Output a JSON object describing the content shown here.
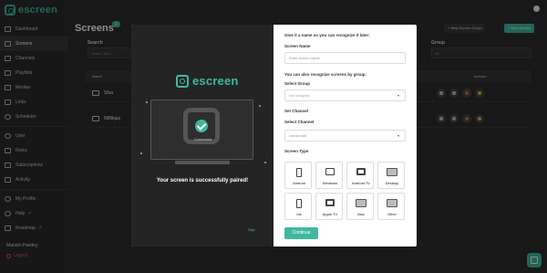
{
  "app": {
    "brand": "escreen"
  },
  "sidebar": {
    "items": [
      {
        "label": "Dashboard",
        "icon": "home-icon"
      },
      {
        "label": "Screens",
        "icon": "monitor-icon",
        "active": true
      },
      {
        "label": "Channels",
        "icon": "channel-icon"
      },
      {
        "label": "Playlists",
        "icon": "playlist-icon"
      },
      {
        "label": "Medias",
        "icon": "media-icon"
      },
      {
        "label": "Links",
        "icon": "link-icon"
      },
      {
        "label": "Scheduler",
        "icon": "clock-icon"
      },
      {
        "label": "User",
        "icon": "user-icon"
      },
      {
        "label": "Roles",
        "icon": "roles-icon"
      },
      {
        "label": "Subscriptions",
        "icon": "subscription-icon"
      },
      {
        "label": "Activity",
        "icon": "activity-icon"
      },
      {
        "label": "My Profile",
        "icon": "profile-icon"
      },
      {
        "label": "Help",
        "icon": "help-icon"
      },
      {
        "label": "Roadmap",
        "icon": "roadmap-icon"
      }
    ],
    "user_name": "Manish Pandey",
    "logout": "Logout"
  },
  "main": {
    "title": "Screens",
    "count": "2",
    "new_group": "+ New Screen Group",
    "new_screen": "+ New Screen",
    "search_label": "Search",
    "search_placeholder": "Search here",
    "group_label": "Group",
    "group_value": "All",
    "columns": {
      "name": "Name",
      "actions": "Actions"
    },
    "rows": [
      {
        "name": "Sfsa"
      },
      {
        "name": "N89kjas"
      }
    ]
  },
  "modal": {
    "brand": "escreen",
    "connected": "Connected",
    "paired_message": "Your screen is successfully paired!",
    "heading": "Give it a name so you can recognize it later:",
    "screen_name_label": "Screen Name",
    "screen_name_placeholder": "Enter screen name",
    "group_hint": "You can also recognize screens by group:",
    "select_group_label": "Select Group",
    "select_group_value": "Un-Grouped",
    "set_channel_label": "Set Channel",
    "select_channel_label": "Select Channel",
    "select_channel_value": "checkmate",
    "screen_type_label": "Screen Type",
    "types": [
      "Android",
      "Windows",
      "Android TV",
      "Desktop",
      "Ios",
      "Apple TV",
      "Mac",
      "Other"
    ],
    "continue": "Continue",
    "skip": "Skip"
  },
  "colors": {
    "accent": "#3fb8a0",
    "danger": "#e05a5a",
    "warning": "#e8b13c"
  }
}
